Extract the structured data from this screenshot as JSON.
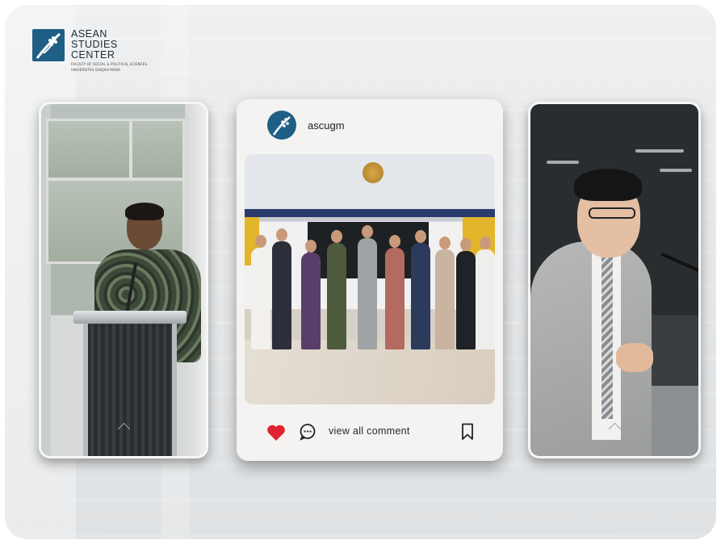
{
  "brand": {
    "line1": "ASEAN",
    "line2": "STUDIES",
    "line3": "CENTER",
    "subline1": "FACULTY OF SOCIAL & POLITICAL SCIENCES",
    "subline2": "UNIVERSITAS GADJAH MADA",
    "color": "#1f5f86"
  },
  "post": {
    "username": "ascugm",
    "comment_label": "view all comment",
    "like_icon": "heart-icon",
    "comment_icon": "comment-bubble-icon",
    "save_icon": "bookmark-icon",
    "like_color": "#e0242f"
  },
  "cards": {
    "left_icon": "chevron-up-icon",
    "right_icon": "chevron-up-icon"
  }
}
